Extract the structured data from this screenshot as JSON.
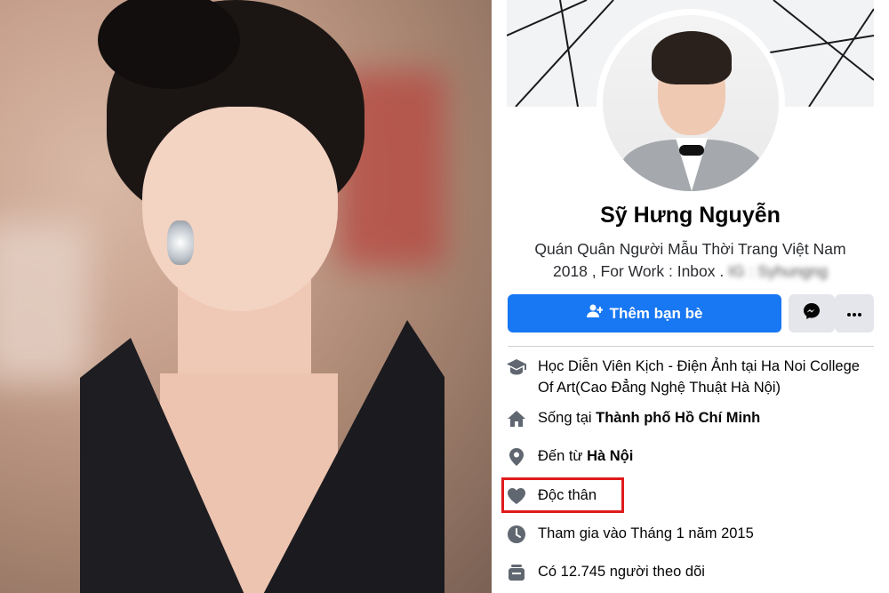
{
  "profile": {
    "name": "Sỹ Hưng Nguyễn",
    "bio_line1": "Quán Quân Người Mẫu Thời Trang Việt Nam",
    "bio_line2": "2018 , For Work : Inbox .",
    "bio_blurred": "IG : Syhungng",
    "add_friend_label": "Thêm bạn bè"
  },
  "info": {
    "education_prefix": "Học Diễn Viên Kịch - Điện Ảnh tại Ha Noi College",
    "education_line2": "Of Art(Cao Đẳng Nghệ Thuật Hà Nội)",
    "lives_prefix": "Sống tại ",
    "lives_city": "Thành phố Hồ Chí Minh",
    "from_prefix": "Đến từ ",
    "from_city": "Hà Nội",
    "relationship": "Độc thân",
    "joined": "Tham gia vào Tháng 1 năm 2015",
    "followers": "Có 12.745 người theo dõi"
  },
  "colors": {
    "primary_button": "#1877f2",
    "secondary_button": "#e4e6eb",
    "icon_gray": "#606770",
    "highlight_red": "#e01b1b"
  },
  "icons": [
    "person-add-icon",
    "messenger-icon",
    "more-icon",
    "graduation-cap-icon",
    "home-icon",
    "location-pin-icon",
    "heart-icon",
    "clock-icon",
    "followers-icon"
  ]
}
